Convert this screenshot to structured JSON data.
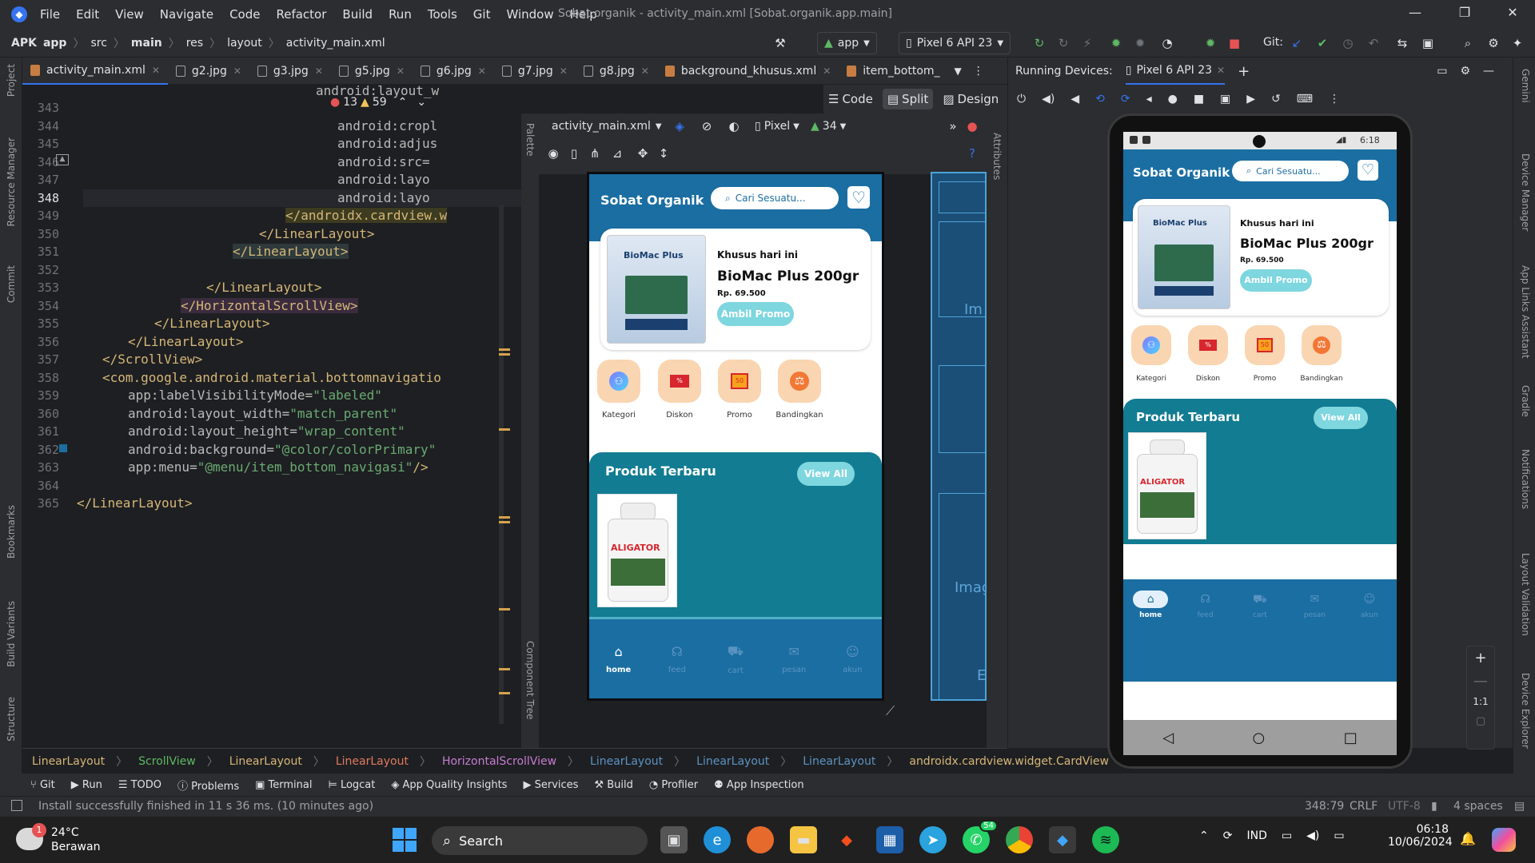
{
  "window": {
    "title": "Sobat.organik - activity_main.xml [Sobat.organik.app.main]",
    "menu": [
      "File",
      "Edit",
      "View",
      "Navigate",
      "Code",
      "Refactor",
      "Build",
      "Run",
      "Tools",
      "Git",
      "Window",
      "Help"
    ]
  },
  "nav": {
    "crumbs": [
      "APK",
      "app",
      "src",
      "main",
      "res",
      "layout",
      "activity_main.xml"
    ],
    "run_config": "app",
    "device": "Pixel 6 API 23",
    "git_label": "Git:"
  },
  "tabs": [
    "activity_main.xml",
    "g2.jpg",
    "g3.jpg",
    "g5.jpg",
    "g6.jpg",
    "g7.jpg",
    "g8.jpg",
    "background_khusus.xml",
    "item_bottom_"
  ],
  "left_strip": [
    "Project",
    "Resource Manager",
    "Commit",
    "Bookmarks",
    "Build Variants",
    "Structure"
  ],
  "right_strip": [
    "Gemini",
    "Device Manager",
    "App Links Assistant",
    "Gradle",
    "Notifications",
    "Layout Validation",
    "Device Explorer"
  ],
  "editor": {
    "lines": [
      "343",
      "344",
      "345",
      "346",
      "347",
      "348",
      "349",
      "350",
      "351",
      "352",
      "353",
      "354",
      "355",
      "356",
      "357",
      "358",
      "359",
      "360",
      "361",
      "362",
      "363",
      "364",
      "365"
    ],
    "errors": "13",
    "warnings": "59",
    "code": {
      "l343": "android:layout_w",
      "l344": "android:cropl",
      "l345": "android:adjus",
      "l346": "android:src=",
      "l347": "android:layo",
      "l348": "android:layo",
      "l349": "</androidx.cardview.w",
      "l350": "</LinearLayout>",
      "l351": "</LinearLayout>",
      "l353": "</LinearLayout>",
      "l354": "</HorizontalScrollView>",
      "l355": "</LinearLayout>",
      "l356": "</LinearLayout>",
      "l357": "</ScrollView>",
      "l358": "<com.google.android.material.bottomnavigation.Bot",
      "l359a": "app:labelVisibilityMode=",
      "l359b": "\"labeled\"",
      "l360a": "android:layout_width=",
      "l360b": "\"match_parent\"",
      "l361a": "android:layout_height=",
      "l361b": "\"wrap_content\"",
      "l362a": "android:background=",
      "l362b": "\"@color/colorPrimary\"",
      "l363a": "app:menu=",
      "l363b": "\"@menu/item_bottom_navigasi\"",
      "l363c": "/>",
      "l365": "</LinearLayout>"
    }
  },
  "viewmodes": [
    "Code",
    "Split",
    "Design"
  ],
  "design": {
    "file": "activity_main.xml",
    "device": "Pixel",
    "api": "34",
    "palette": "Palette",
    "component_tree": "Component Tree",
    "attributes": "Attributes",
    "blueprint_text1": "Im",
    "blueprint_text2": "Imag",
    "blueprint_text3": "E"
  },
  "running": {
    "label": "Running Devices:",
    "device": "Pixel 6 API 23"
  },
  "app": {
    "title": "Sobat Organik",
    "search_placeholder": "Cari Sesuatu...",
    "promo_tag": "Khusus hari ini",
    "promo_name": "BioMac Plus 200gr",
    "promo_price": "Rp.  69.500",
    "promo_button": "Ambil Promo",
    "pkg_label": "BioMac Plus",
    "categories": [
      "Kategori",
      "Diskon",
      "Promo",
      "Bandingkan"
    ],
    "produk_title": "Produk Terbaru",
    "view_all": "View All",
    "product_name": "ALIGATOR",
    "nav": [
      "home",
      "feed",
      "cart",
      "pesan",
      "akun"
    ],
    "status_time": "6:18"
  },
  "breadcrumb": [
    "LinearLayout",
    "ScrollView",
    "LinearLayout",
    "LinearLayout",
    "HorizontalScrollView",
    "LinearLayout",
    "LinearLayout",
    "LinearLayout",
    "androidx.cardview.widget.CardView"
  ],
  "toolwindows": [
    "Git",
    "Run",
    "TODO",
    "Problems",
    "Terminal",
    "Logcat",
    "App Quality Insights",
    "Services",
    "Build",
    "Profiler",
    "App Inspection"
  ],
  "status": {
    "message": "Install successfully finished in 11 s 36 ms. (10 minutes ago)",
    "position": "348:79",
    "eol": "CRLF",
    "encoding": "UTF-8",
    "indent": "4 spaces"
  },
  "taskbar": {
    "temp": "24°C",
    "weather": "Berawan",
    "search": "Search",
    "lang": "IND",
    "time": "06:18",
    "date": "10/06/2024",
    "wa_badge": "54",
    "weather_badge": "1"
  },
  "colors": {
    "accent": "#3574f0",
    "app_primary": "#1b6ea2",
    "produk_bg": "#127c92",
    "pill": "#7ed6df",
    "cat_bg": "#f9d5b1"
  }
}
